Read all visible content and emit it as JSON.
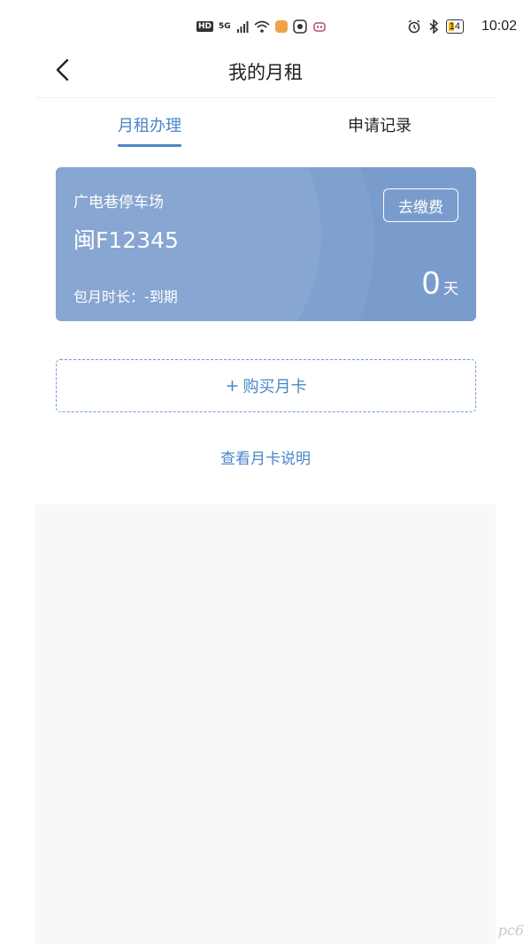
{
  "status_bar": {
    "left_badge_hd": "HD",
    "left_5g": "5G",
    "battery_level": "14",
    "time": "10:02"
  },
  "header": {
    "title": "我的月租"
  },
  "tabs": [
    {
      "label": "月租办理",
      "active": true
    },
    {
      "label": "申请记录",
      "active": false
    }
  ],
  "card": {
    "parking_lot": "广电巷停车场",
    "plate": "闽F12345",
    "duration_text": "包月时长：-到期",
    "pay_button": "去缴费",
    "days_value": "0",
    "days_unit": "天",
    "color": "#7a9ccd"
  },
  "buy_card": {
    "plus": "+",
    "label": "购买月卡"
  },
  "card_info_link": "查看月卡说明",
  "watermark": "pc6",
  "colors": {
    "accent": "#4a86c6",
    "card_bg": "#7a9ccd",
    "panel_bg": "#f8f8f8"
  }
}
